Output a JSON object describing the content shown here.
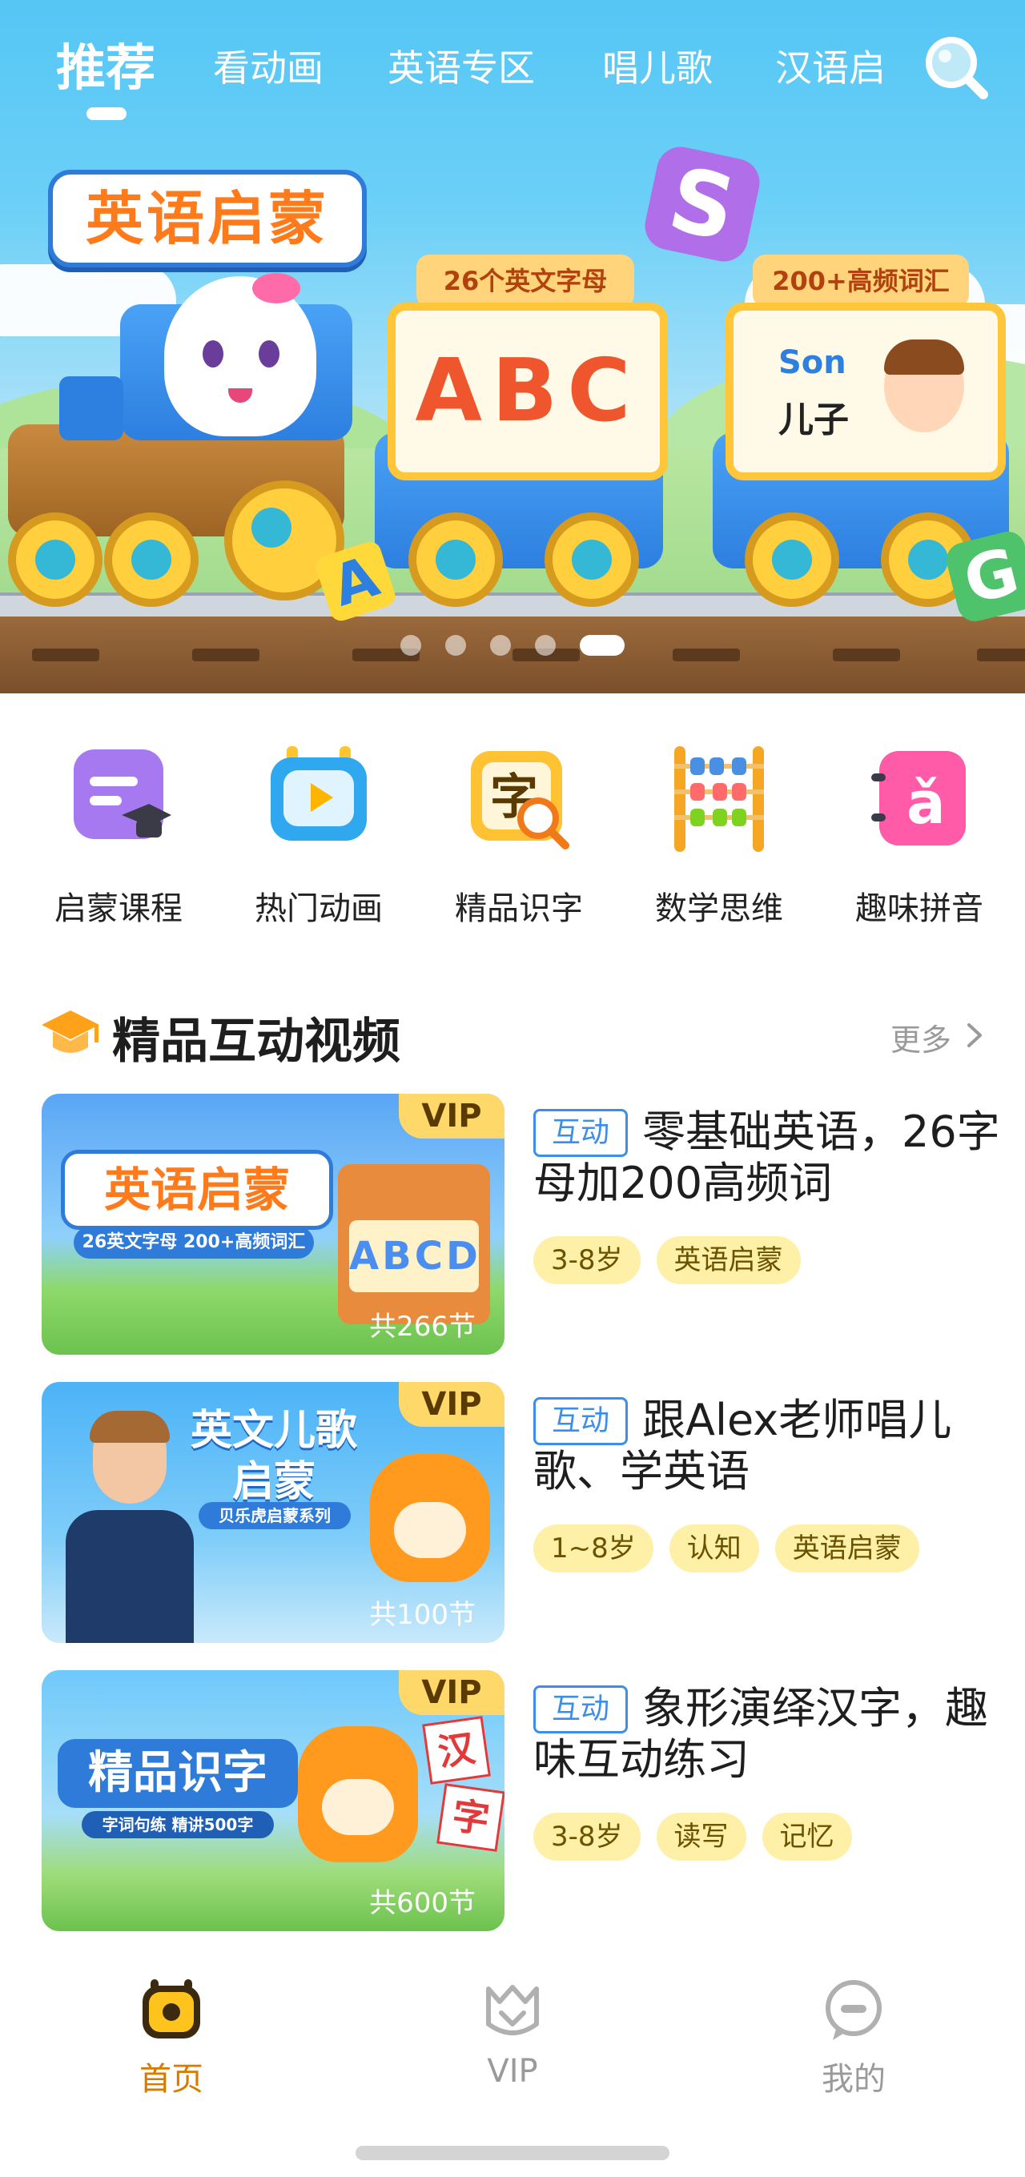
{
  "top_tabs": [
    {
      "label": "推荐",
      "active": true
    },
    {
      "label": "看动画"
    },
    {
      "label": "英语专区"
    },
    {
      "label": "唱儿歌"
    },
    {
      "label": "汉语启"
    }
  ],
  "banner": {
    "headline": "英语启蒙",
    "card1_tag": "26个英文字母",
    "card1_text": "ABC",
    "card2_tag": "200+高频词汇",
    "card2_word": "Son",
    "card2_meaning": "儿子",
    "slide_count": 5,
    "active_slide": 5
  },
  "categories": [
    {
      "label": "启蒙课程",
      "icon": "course-book-icon"
    },
    {
      "label": "热门动画",
      "icon": "tv-play-icon"
    },
    {
      "label": "精品识字",
      "icon": "character-magnifier-icon"
    },
    {
      "label": "数学思维",
      "icon": "abacus-icon"
    },
    {
      "label": "趣味拼音",
      "icon": "pinyin-book-icon"
    }
  ],
  "section": {
    "title": "精品互动视频",
    "more_label": "更多",
    "courses": [
      {
        "thumb_line1": "英语启蒙",
        "thumb_line2": "26英文字母 200+高频词汇",
        "vip": "VIP",
        "lessons": "共266节",
        "type_badge": "互动",
        "title": "零基础英语，26字母加200高频词",
        "tags": [
          "3-8岁",
          "英语启蒙"
        ]
      },
      {
        "thumb_line1": "英文儿歌",
        "thumb_line2": "启蒙",
        "thumb_line3": "贝乐虎启蒙系列",
        "vip": "VIP",
        "lessons": "共100节",
        "type_badge": "互动",
        "title": "跟Alex老师唱儿歌、学英语",
        "tags": [
          "1~8岁",
          "认知",
          "英语启蒙"
        ]
      },
      {
        "thumb_line1": "精品识字",
        "thumb_line2": "字词句练 精讲500字",
        "thumb_hanzi1": "汉",
        "thumb_hanzi2": "字",
        "vip": "VIP",
        "lessons": "共600节",
        "type_badge": "互动",
        "title": "象形演绎汉字，趣味互动练习",
        "tags": [
          "3-8岁",
          "读写",
          "记忆"
        ]
      }
    ]
  },
  "bottom_nav": [
    {
      "label": "首页",
      "icon": "home-tv-icon",
      "active": true
    },
    {
      "label": "VIP",
      "icon": "vip-crown-icon"
    },
    {
      "label": "我的",
      "icon": "chat-bubble-icon"
    }
  ],
  "colors": {
    "accent": "#ffb400",
    "sky": "#55c6f5",
    "vip": "#ffd86a",
    "badge_blue": "#3d8ee6"
  }
}
